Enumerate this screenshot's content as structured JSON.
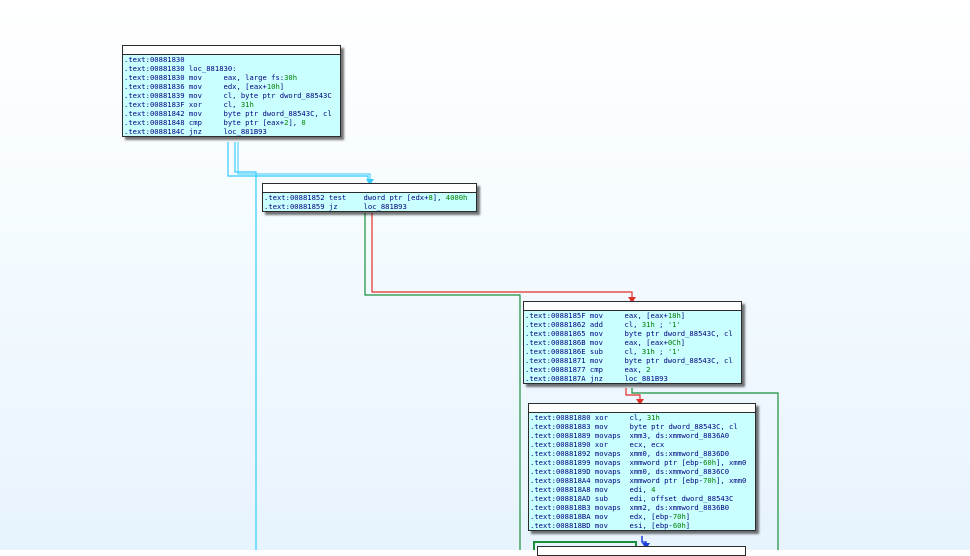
{
  "graph": {
    "nodes": [
      {
        "id": "loc_881830",
        "lines": [
          [
            {
              "t": ".text:00881830"
            }
          ],
          [
            {
              "t": ".text:00881830 loc_881830:"
            }
          ],
          [
            {
              "t": ".text:00881830 mov     eax, large fs:"
            },
            {
              "t": "30h",
              "c": "num"
            }
          ],
          [
            {
              "t": ".text:00881836 mov     edx, [eax+"
            },
            {
              "t": "10h",
              "c": "num"
            },
            {
              "t": "]"
            }
          ],
          [
            {
              "t": ".text:00881839 mov     cl, byte ptr dword_88543C"
            }
          ],
          [
            {
              "t": ".text:0088183F xor     cl, "
            },
            {
              "t": "31h",
              "c": "num"
            }
          ],
          [
            {
              "t": ".text:00881842 mov     byte ptr dword_88543C, cl"
            }
          ],
          [
            {
              "t": ".text:00881848 cmp     byte ptr [eax+"
            },
            {
              "t": "2",
              "c": "num"
            },
            {
              "t": "], "
            },
            {
              "t": "0",
              "c": "num"
            }
          ],
          [
            {
              "t": ".text:0088184C jnz     loc_881B93"
            }
          ]
        ]
      },
      {
        "id": "block_881852",
        "lines": [
          [
            {
              "t": ".text:00881852 test    dword ptr [edx+"
            },
            {
              "t": "8",
              "c": "num"
            },
            {
              "t": "], "
            },
            {
              "t": "4000h",
              "c": "num"
            }
          ],
          [
            {
              "t": ".text:00881859 jz      loc_881B93"
            }
          ]
        ]
      },
      {
        "id": "block_88185F",
        "lines": [
          [
            {
              "t": ".text:0088185F mov     eax, [eax+"
            },
            {
              "t": "18h",
              "c": "num"
            },
            {
              "t": "]"
            }
          ],
          [
            {
              "t": ".text:00881862 add     cl, "
            },
            {
              "t": "31h",
              "c": "num"
            },
            {
              "t": " ; "
            },
            {
              "t": "'1'",
              "c": "str"
            }
          ],
          [
            {
              "t": ".text:00881865 mov     byte ptr dword_88543C, cl"
            }
          ],
          [
            {
              "t": ".text:0088186B mov     eax, [eax+"
            },
            {
              "t": "0Ch",
              "c": "num"
            },
            {
              "t": "]"
            }
          ],
          [
            {
              "t": ".text:0088186E sub     cl, "
            },
            {
              "t": "31h",
              "c": "num"
            },
            {
              "t": " ; "
            },
            {
              "t": "'1'",
              "c": "str"
            }
          ],
          [
            {
              "t": ".text:00881871 mov     byte ptr dword_88543C, cl"
            }
          ],
          [
            {
              "t": ".text:00881877 cmp     eax, "
            },
            {
              "t": "2",
              "c": "num"
            }
          ],
          [
            {
              "t": ".text:0088187A jnz     loc_881B93"
            }
          ]
        ]
      },
      {
        "id": "block_881880",
        "lines": [
          [
            {
              "t": ".text:00881880 xor     cl, "
            },
            {
              "t": "31h",
              "c": "num"
            }
          ],
          [
            {
              "t": ".text:00881883 mov     byte ptr dword_88543C, cl"
            }
          ],
          [
            {
              "t": ".text:00881889 movaps  xmm3, ds:xmmword_8836A0"
            }
          ],
          [
            {
              "t": ".text:00881890 xor     ecx, ecx"
            }
          ],
          [
            {
              "t": ".text:00881892 movaps  xmm0, ds:xmmword_8836D0"
            }
          ],
          [
            {
              "t": ".text:00881899 movaps  xmmword ptr [ebp-"
            },
            {
              "t": "60h",
              "c": "num"
            },
            {
              "t": "], xmm0"
            }
          ],
          [
            {
              "t": ".text:0088189D movaps  xmm0, ds:xmmword_8836C0"
            }
          ],
          [
            {
              "t": ".text:008818A4 movaps  xmmword ptr [ebp-"
            },
            {
              "t": "70h",
              "c": "num"
            },
            {
              "t": "], xmm0"
            }
          ],
          [
            {
              "t": ".text:008818A8 mov     edi, "
            },
            {
              "t": "4",
              "c": "num"
            }
          ],
          [
            {
              "t": ".text:008818AD sub     edi, offset dword_88543C"
            }
          ],
          [
            {
              "t": ".text:008818B3 movaps  xmm2, ds:xmmword_8836B0"
            }
          ],
          [
            {
              "t": ".text:008818BA mov     edx, [ebp-"
            },
            {
              "t": "70h",
              "c": "num"
            },
            {
              "t": "]"
            }
          ],
          [
            {
              "t": ".text:008818BD mov     esi, [ebp-"
            },
            {
              "t": "60h",
              "c": "num"
            },
            {
              "t": "]"
            }
          ]
        ]
      }
    ]
  },
  "colors": {
    "background_top": "#ffffff",
    "background_bottom": "#e7f3fd",
    "node_body": "#c9ffff",
    "node_border": "#2b2b2b",
    "edge_unconditional": "#33ccff",
    "edge_true": "#1a8f3c",
    "edge_false": "#e0302a",
    "edge_blue": "#1c3fd8",
    "instruction_text": "#000080",
    "immediate_text": "#008000"
  }
}
